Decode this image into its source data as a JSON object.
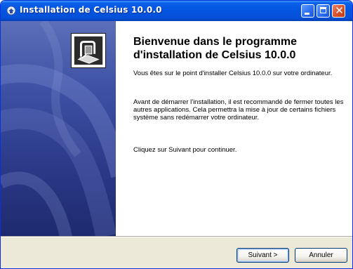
{
  "window": {
    "title": "Installation de Celsius 10.0.0",
    "icon": "installer-icon"
  },
  "titlebar_buttons": {
    "minimize": "minimize-icon",
    "maximize": "maximize-icon",
    "close": "close-icon",
    "close_glyph": "✕"
  },
  "sidebar": {
    "icon": "installer-box-icon"
  },
  "content": {
    "heading": "Bienvenue dans le programme d'installation de Celsius 10.0.0",
    "paragraph_1": "Vous êtes sur le point d'installer Celsius 10.0.0 sur votre ordinateur.",
    "paragraph_2": "Avant de démarrer l'installation, il est recommandé de fermer toutes les autres applications. Cela permettra la mise à jour de certains fichiers système sans redémarrer votre ordinateur.",
    "paragraph_3": "Cliquez sur Suivant pour continuer."
  },
  "footer": {
    "next_label": "Suivant >",
    "cancel_label": "Annuler"
  },
  "colors": {
    "titlebar": "#0454e0",
    "sidebar": "#2c3b8a",
    "close_button": "#d8512c",
    "window_bg": "#ece9d8"
  }
}
